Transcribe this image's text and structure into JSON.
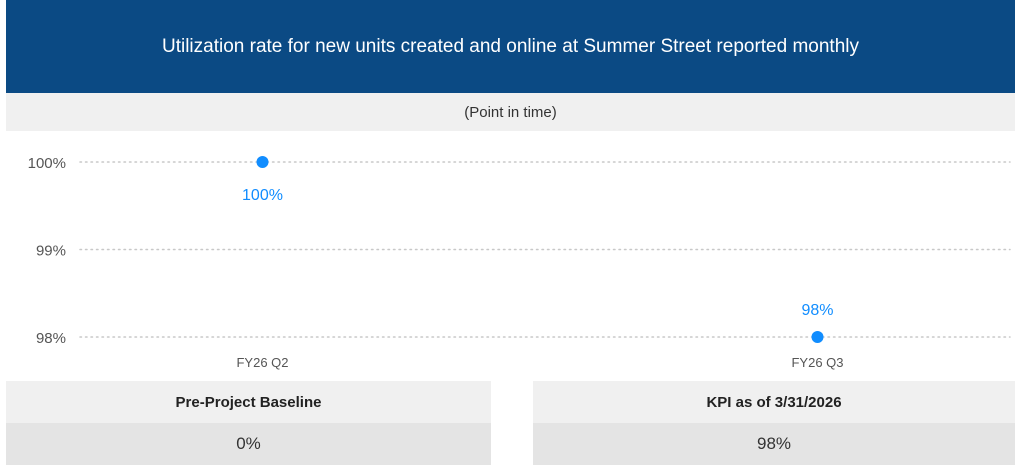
{
  "header": {
    "title": "Utilization rate for new units created and online at Summer Street reported monthly",
    "subtitle": "(Point in time)"
  },
  "chart_data": {
    "type": "scatter",
    "categories": [
      "FY26 Q2",
      "FY26 Q3"
    ],
    "series": [
      {
        "values": [
          100,
          98
        ],
        "labels": [
          "100%",
          "98%"
        ]
      }
    ],
    "yticks": [
      "100%",
      "99%",
      "98%"
    ],
    "ytick_values": [
      100,
      99,
      98
    ],
    "ylim": [
      98,
      100
    ],
    "grid": true,
    "colors": {
      "point": "#118dff",
      "label": "#118dff",
      "grid": "#c8c8c8",
      "tick": "#555555"
    }
  },
  "kpis": {
    "baseline": {
      "label": "Pre-Project Baseline",
      "value": "0%"
    },
    "current": {
      "label": "KPI as of 3/31/2026",
      "value": "98%"
    }
  },
  "colors": {
    "header_bg": "#0b4a84",
    "panel_bg": "#f0f0f0"
  }
}
